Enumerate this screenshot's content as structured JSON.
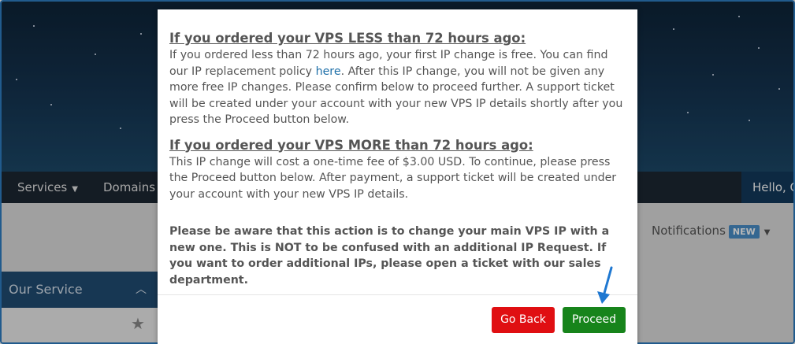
{
  "navbar": {
    "items": [
      {
        "label": "Services",
        "has_caret": true
      },
      {
        "label": "Domains",
        "has_caret": false
      }
    ],
    "hello": "Hello, C"
  },
  "notifications": {
    "label": "Notifications",
    "badge": "NEW"
  },
  "sidebar_panel": {
    "title": "Our Service"
  },
  "modal": {
    "section1": {
      "title": "If you ordered your VPS LESS than 72 hours ago:",
      "text_before_link": "If you ordered less than 72 hours ago, your first IP change is free. You can find our IP replacement policy ",
      "link_text": "here",
      "text_after_link": ". After this IP change, you will not be given any more free IP changes. Please confirm below to proceed further. A support ticket will be created under your account with your new VPS IP details shortly after you press the Proceed button below."
    },
    "section2": {
      "title": "If you ordered your VPS MORE than 72 hours ago:",
      "text": "This IP change will cost a one-time fee of $3.00 USD. To continue, please press the Proceed button below. After payment, a support ticket will be created under your account with your new VPS IP details."
    },
    "warning": "Please be aware that this action is to change your main VPS IP with a new one. This is NOT to be confused with an additional IP Request. If you want to order additional IPs, please open a ticket with our sales department.",
    "buttons": {
      "back": "Go Back",
      "proceed": "Proceed"
    }
  },
  "colors": {
    "accent": "#2f7fc4",
    "danger": "#e00f12",
    "success": "#17841b",
    "navbar": "#1d2733",
    "panel": "#214d74"
  }
}
